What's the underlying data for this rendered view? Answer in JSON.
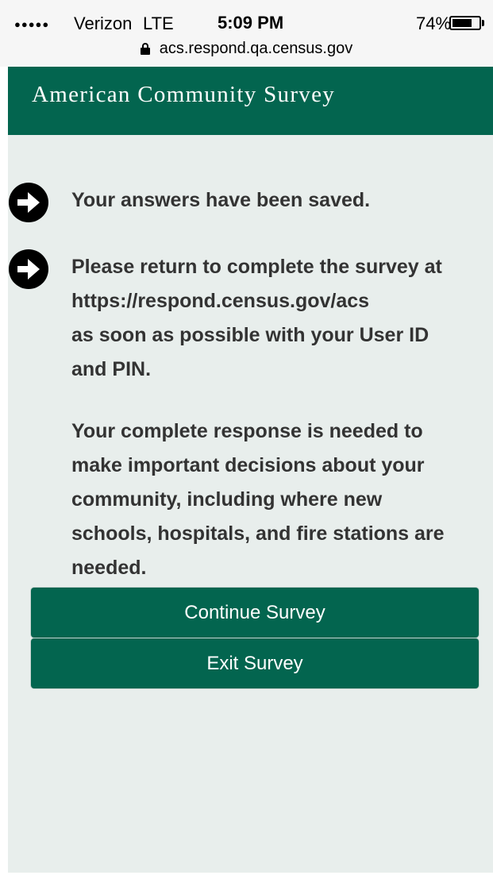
{
  "status_bar": {
    "signal_dots": "●●●●●",
    "carrier": "Verizon",
    "network": "LTE",
    "time": "5:09 PM",
    "battery_percent": "74%",
    "battery_level": 0.74
  },
  "browser": {
    "url": "acs.respond.qa.census.gov"
  },
  "header": {
    "title": "American Community Survey"
  },
  "messages": {
    "saved": "Your answers have been saved.",
    "return_lines": [
      "Please return to complete the survey at",
      "https://respond.census.gov/acs",
      "as soon as possible with your User ID",
      "and PIN."
    ],
    "importance_lines": [
      "Your complete response is needed to",
      "make important decisions about your",
      "community, including where new",
      "schools, hospitals, and fire stations are",
      "needed."
    ]
  },
  "actions": {
    "continue_label": "Continue Survey",
    "exit_label": "Exit Survey"
  },
  "colors": {
    "brand_green": "#03654f",
    "content_background": "#e8eeec",
    "body_text": "#333333"
  },
  "icons": {
    "bullet": "arrow-right-circle-icon",
    "lock": "lock-icon"
  }
}
